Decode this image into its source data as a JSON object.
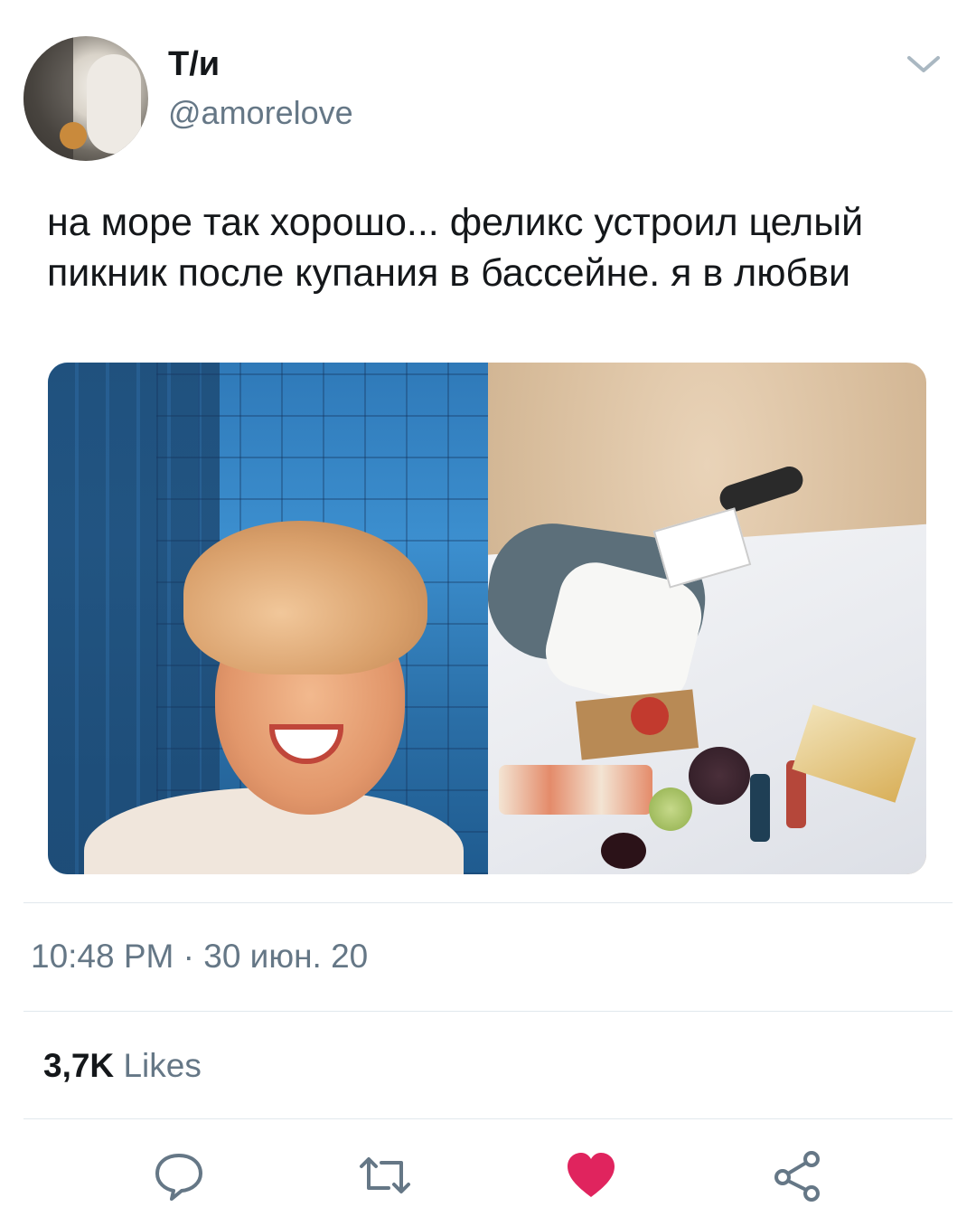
{
  "tweet": {
    "author": {
      "display_name": "Т/и",
      "handle": "@amorelove"
    },
    "text": "на море так хорошо... феликс устроил целый пикник после купания в бассейне. я в любви",
    "timestamp": "10:48 PM · 30 июн. 20",
    "likes": {
      "count": "3,7K",
      "label": "Likes"
    }
  },
  "actions": {
    "reply_icon": "speech-bubble-icon",
    "retweet_icon": "retweet-icon",
    "like_icon": "heart-icon",
    "share_icon": "share-icon"
  },
  "colors": {
    "text_primary": "#14171a",
    "text_secondary": "#657786",
    "like_active": "#e0245e",
    "icon_gray": "#657786",
    "divider": "#e1e8ed"
  }
}
